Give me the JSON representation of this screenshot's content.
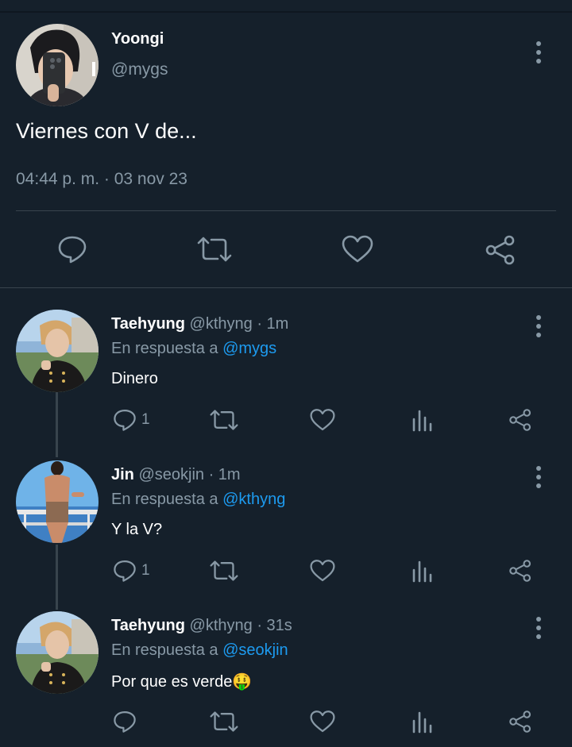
{
  "main_tweet": {
    "author_name": "Yoongi",
    "author_handle": "@mygs",
    "text": "Viernes con V de...",
    "timestamp": "04:44 p. m. · 03 nov 23",
    "actions": [
      "reply-icon",
      "retweet-icon",
      "like-icon",
      "share-icon"
    ]
  },
  "replies": [
    {
      "author_name": "Taehyung",
      "author_handle": "@kthyng",
      "time": "· 1m",
      "reply_prefix": "En respuesta a",
      "reply_to": "@mygs",
      "text": "Dinero",
      "reply_count": "1"
    },
    {
      "author_name": "Jin",
      "author_handle": "@seokjin",
      "time": "· 1m",
      "reply_prefix": "En respuesta a",
      "reply_to": "@kthyng",
      "text": "Y la V?",
      "reply_count": "1"
    },
    {
      "author_name": "Taehyung",
      "author_handle": "@kthyng",
      "time": "· 31s",
      "reply_prefix": "En respuesta a",
      "reply_to": "@seokjin",
      "text": "Por que es verde",
      "emoji": "🤑",
      "reply_count": ""
    }
  ],
  "colors": {
    "background": "#15202b",
    "muted": "#8899a6",
    "link": "#1d9bf0",
    "divider": "#38444d"
  }
}
